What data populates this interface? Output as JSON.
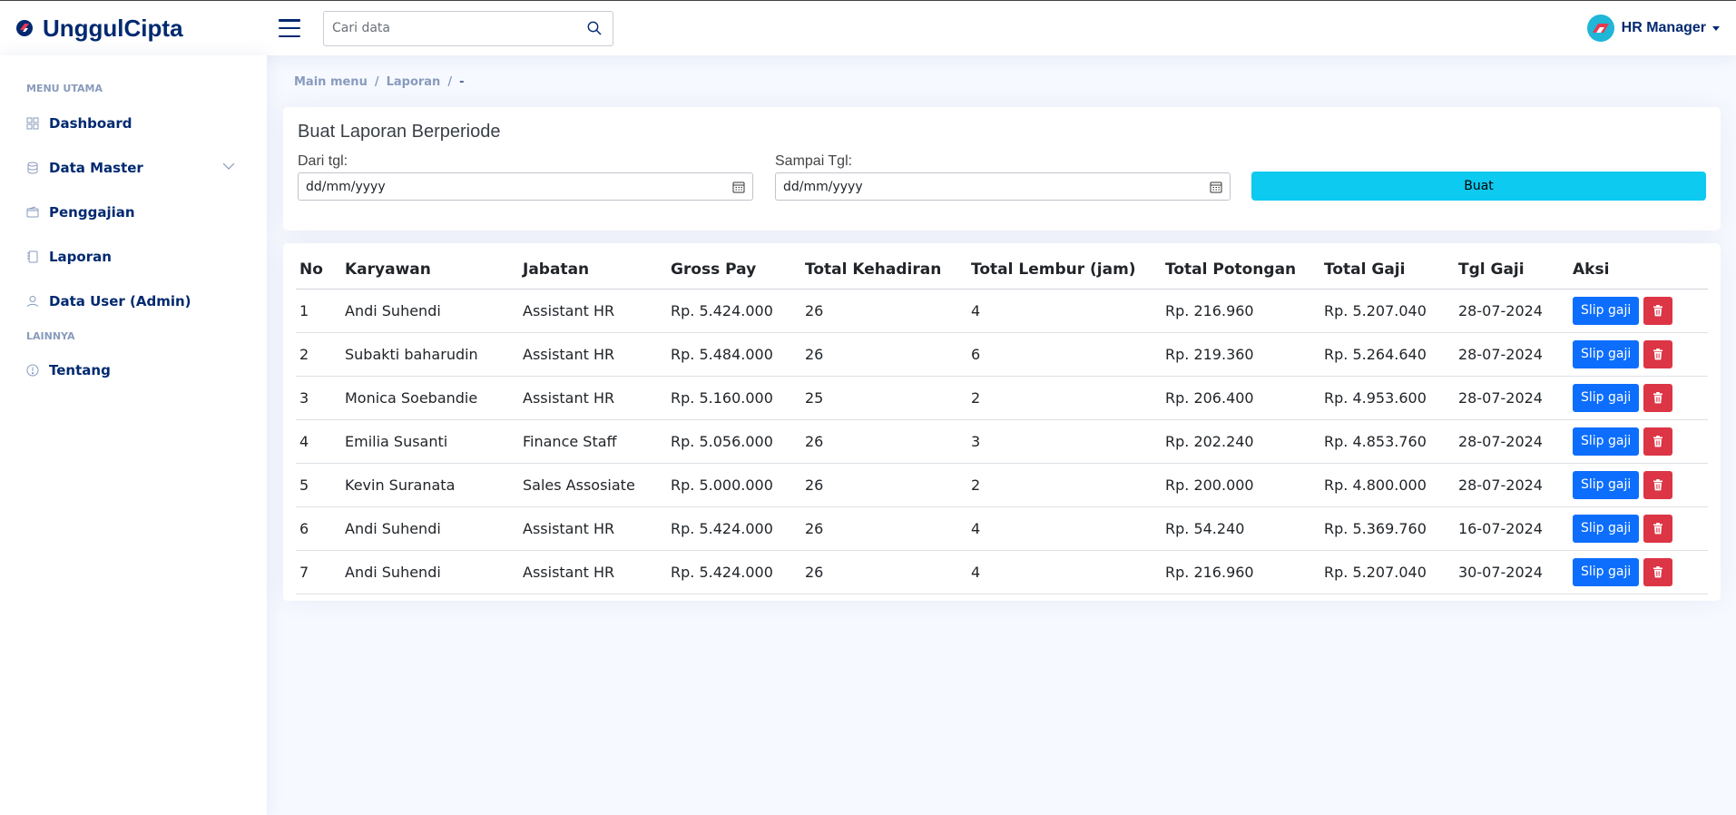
{
  "header": {
    "brand": "UnggulCipta",
    "search_placeholder": "Cari data",
    "profile_name": "HR Manager"
  },
  "sidebar": {
    "heading_main": "MENU UTAMA",
    "heading_other": "LAINNYA",
    "items": [
      {
        "label": "Dashboard",
        "icon": "grid-icon"
      },
      {
        "label": "Data Master",
        "icon": "database-icon"
      },
      {
        "label": "Penggajian",
        "icon": "wallet-icon"
      },
      {
        "label": "Laporan",
        "icon": "journal-icon"
      },
      {
        "label": "Data User (Admin)",
        "icon": "person-icon"
      },
      {
        "label": "Tentang",
        "icon": "info-circle-icon"
      }
    ]
  },
  "breadcrumb": [
    "Main menu",
    "Laporan",
    "-"
  ],
  "form": {
    "title": "Buat Laporan Berperiode",
    "from_label": "Dari tgl:",
    "to_label": "Sampai Tgl:",
    "from_value": "dd/mm/yyyy",
    "to_value": "dd/mm/yyyy",
    "submit_label": "Buat"
  },
  "table": {
    "headers": [
      "No",
      "Karyawan",
      "Jabatan",
      "Gross Pay",
      "Total Kehadiran",
      "Total Lembur (jam)",
      "Total Potongan",
      "Total Gaji",
      "Tgl Gaji",
      "Aksi"
    ],
    "slip_label": "Slip gaji",
    "rows": [
      [
        "1",
        "Andi Suhendi",
        "Assistant HR",
        "Rp. 5.424.000",
        "26",
        "4",
        "Rp. 216.960",
        "Rp. 5.207.040",
        "28-07-2024"
      ],
      [
        "2",
        "Subakti baharudin",
        "Assistant HR",
        "Rp. 5.484.000",
        "26",
        "6",
        "Rp. 219.360",
        "Rp. 5.264.640",
        "28-07-2024"
      ],
      [
        "3",
        "Monica Soebandie",
        "Assistant HR",
        "Rp. 5.160.000",
        "25",
        "2",
        "Rp. 206.400",
        "Rp. 4.953.600",
        "28-07-2024"
      ],
      [
        "4",
        "Emilia Susanti",
        "Finance Staff",
        "Rp. 5.056.000",
        "26",
        "3",
        "Rp. 202.240",
        "Rp. 4.853.760",
        "28-07-2024"
      ],
      [
        "5",
        "Kevin Suranata",
        "Sales Assosiate",
        "Rp. 5.000.000",
        "26",
        "2",
        "Rp. 200.000",
        "Rp. 4.800.000",
        "28-07-2024"
      ],
      [
        "6",
        "Andi Suhendi",
        "Assistant HR",
        "Rp. 5.424.000",
        "26",
        "4",
        "Rp. 54.240",
        "Rp. 5.369.760",
        "16-07-2024"
      ],
      [
        "7",
        "Andi Suhendi",
        "Assistant HR",
        "Rp. 5.424.000",
        "26",
        "4",
        "Rp. 216.960",
        "Rp. 5.207.040",
        "30-07-2024"
      ]
    ]
  },
  "colors": {
    "primary": "#012970",
    "info": "#0dcaf0",
    "slip": "#0d6efd",
    "delete": "#dc3545"
  }
}
